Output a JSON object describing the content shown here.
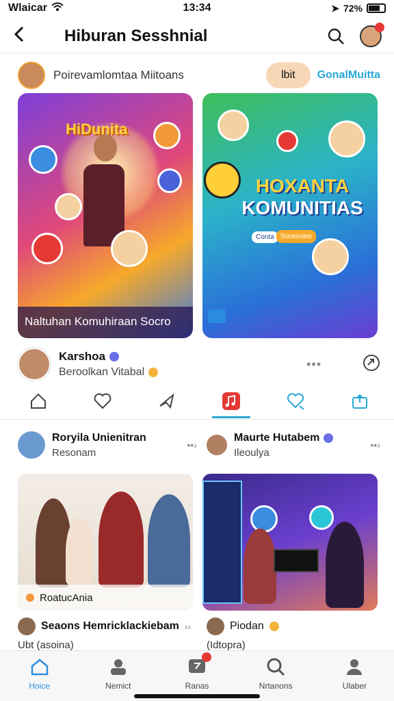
{
  "status_bar": {
    "carrier": "Wlaicar",
    "time": "13:34",
    "battery": "72%"
  },
  "header": {
    "title": "Hiburan Sesshnial",
    "back_icon": "chevron-left-icon",
    "search_icon": "search-icon"
  },
  "post1": {
    "page_name": "Poirevamlomtaa Miitoans",
    "pill_button": "lbit",
    "community_link": "GonalMuitta",
    "card_left": {
      "title": "HiDunita",
      "caption": "Naltuhan Komuhiraan Socro"
    },
    "card_right": {
      "title_line1": "HOXANTA",
      "title_line2": "KOMUNITIAS",
      "badge1": "Conta",
      "badge2": "Sorasnam"
    },
    "author": {
      "name": "Karshoa",
      "subtitle": "Beroolkan Vitabal"
    }
  },
  "actions": [
    {
      "icon": "home-outline-icon",
      "active": false
    },
    {
      "icon": "heart-icon",
      "active": false
    },
    {
      "icon": "share-icon",
      "active": false
    },
    {
      "icon": "music-note-icon",
      "active": true
    },
    {
      "icon": "comment-heart-icon",
      "active": false
    },
    {
      "icon": "upload-icon",
      "active": false
    }
  ],
  "post2": {
    "left": {
      "name": "Roryila Unienitran",
      "subtitle": "Resonam",
      "photo_caption": "RoatucAnia",
      "footer_name": "Seaons Hemricklackiebam",
      "footer_sub": "Ubt (asoina)"
    },
    "right": {
      "name": "Maurte Hutabem",
      "subtitle": "Ileoulya",
      "footer_name": "Piodan",
      "footer_sub": "(Idtopra)"
    }
  },
  "bottom_nav": [
    {
      "label": "Hoice",
      "icon": "home-icon",
      "active": true
    },
    {
      "label": "Nemict",
      "icon": "cloud-user-icon",
      "active": false
    },
    {
      "label": "Ranas",
      "icon": "message-icon",
      "active": false,
      "badge": true
    },
    {
      "label": "Nrtanons",
      "icon": "search-icon",
      "active": false
    },
    {
      "label": "Ulaber",
      "icon": "profile-icon",
      "active": false
    }
  ],
  "colors": {
    "accent": "#29a8d8",
    "active_nav": "#2a8de0",
    "badge": "#e53935",
    "music_accent": "#e53935"
  }
}
